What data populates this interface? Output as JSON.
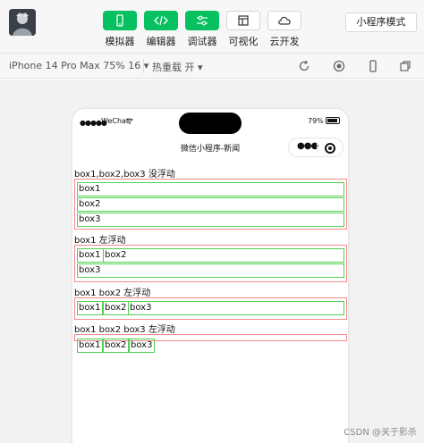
{
  "toolbar": {
    "tools": [
      {
        "label": "模拟器",
        "icon": "phone-simulator-icon"
      },
      {
        "label": "编辑器",
        "icon": "code-icon"
      },
      {
        "label": "调试器",
        "icon": "debugger-icon"
      },
      {
        "label": "可视化",
        "icon": "layout-icon"
      },
      {
        "label": "云开发",
        "icon": "cloud-icon"
      }
    ],
    "mode_label": "小程序模式"
  },
  "subbar": {
    "device": "iPhone 14 Pro Max 75% 16 ▾",
    "hot_reload": "热重载 开 ▾"
  },
  "phone": {
    "carrier": "WeChat",
    "signal": "●●●●●",
    "battery": "79%",
    "nav_title": "微信小程序-新闻",
    "capsule_dots": "●●●"
  },
  "sections": [
    {
      "title": "box1,box2,box3 没浮动",
      "boxes": [
        "box1",
        "box2",
        "box3"
      ]
    },
    {
      "title": "box1 左浮动",
      "boxes": [
        "box1",
        "box2",
        "box3"
      ]
    },
    {
      "title": "box1 box2 左浮动",
      "boxes": [
        "box1",
        "box2",
        "box3"
      ]
    },
    {
      "title": "box1 box2 box3 左浮动",
      "boxes": [
        "box1",
        "box2",
        "box3"
      ]
    }
  ],
  "watermark": "CSDN @关于影杀",
  "colors": {
    "accent": "#07c160",
    "float_container": "#f08a8a",
    "box_border": "#4fd14f"
  }
}
